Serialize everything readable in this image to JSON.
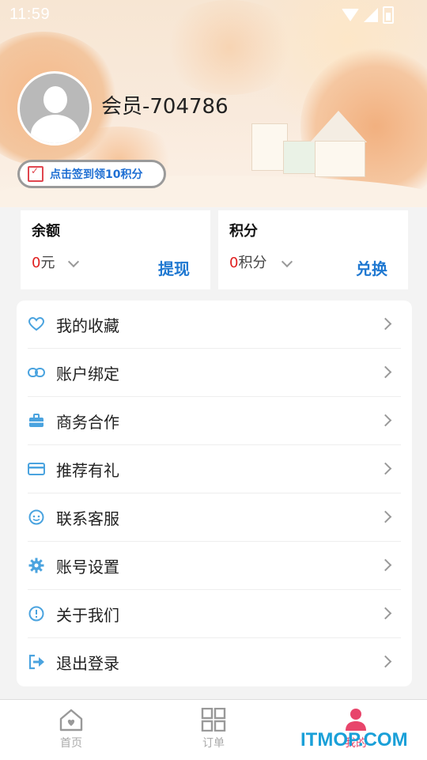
{
  "status_bar": {
    "time": "11:59"
  },
  "profile": {
    "username": "会员-704786",
    "checkin_label": "点击签到领10积分"
  },
  "cards": {
    "balance": {
      "title": "余额",
      "amount": "0",
      "unit": "元",
      "action": "提现"
    },
    "points": {
      "title": "积分",
      "amount": "0",
      "unit": "积分",
      "action": "兑换"
    }
  },
  "menu": [
    {
      "label": "我的收藏",
      "icon": "heart-icon"
    },
    {
      "label": "账户绑定",
      "icon": "link-icon"
    },
    {
      "label": "商务合作",
      "icon": "briefcase-icon"
    },
    {
      "label": "推荐有礼",
      "icon": "card-icon"
    },
    {
      "label": "联系客服",
      "icon": "face-icon"
    },
    {
      "label": "账号设置",
      "icon": "gear-icon"
    },
    {
      "label": "关于我们",
      "icon": "info-icon"
    },
    {
      "label": "退出登录",
      "icon": "logout-icon"
    }
  ],
  "tabbar": [
    {
      "label": "首页",
      "icon": "home-icon"
    },
    {
      "label": "订单",
      "icon": "grid-icon"
    },
    {
      "label": "我的",
      "icon": "user-icon",
      "active": true
    }
  ],
  "watermark": "ITMOP.COM",
  "colors": {
    "accent_blue": "#1f78d1",
    "icon_blue": "#4aa3df",
    "active_pink": "#e8456b",
    "amount_red": "#e02020"
  }
}
